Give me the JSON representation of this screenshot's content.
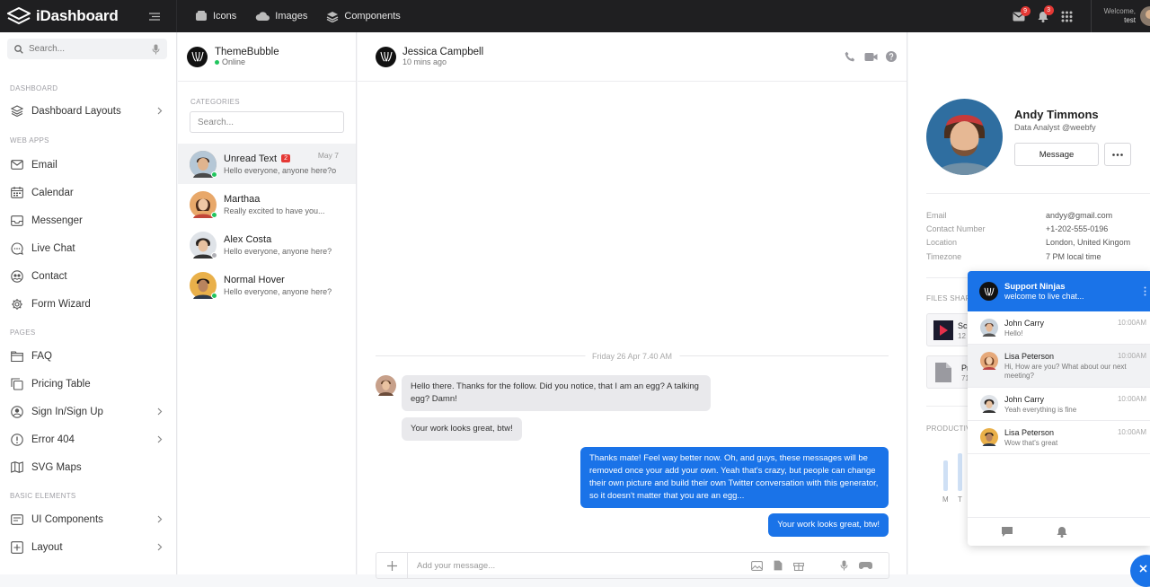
{
  "app": {
    "brand": "iDashboard"
  },
  "topnav": [
    {
      "label": "Icons",
      "icon": "icons-icon"
    },
    {
      "label": "Images",
      "icon": "cloud-icon"
    },
    {
      "label": "Components",
      "icon": "layers-icon"
    }
  ],
  "topright": {
    "mail_count": "9",
    "notif_count": "3",
    "welcome": "Welcome,",
    "username": "test"
  },
  "sidebar": {
    "search_placeholder": "Search...",
    "sections": [
      {
        "label": "DASHBOARD"
      },
      {
        "label": "WEB APPS"
      },
      {
        "label": "PAGES"
      },
      {
        "label": "BASIC ELEMENTS"
      }
    ],
    "items": [
      {
        "label": "Dashboard Layouts",
        "icon": "layers-icon"
      },
      {
        "label": "Email",
        "icon": "mail-icon"
      },
      {
        "label": "Calendar",
        "icon": "calendar-icon"
      },
      {
        "label": "Messenger",
        "icon": "inbox-icon"
      },
      {
        "label": "Live Chat",
        "icon": "chat-icon"
      },
      {
        "label": "Contact",
        "icon": "contact-icon"
      },
      {
        "label": "Form Wizard",
        "icon": "gear-icon"
      },
      {
        "label": "FAQ",
        "icon": "folder-icon"
      },
      {
        "label": "Pricing Table",
        "icon": "copy-icon"
      },
      {
        "label": "Sign In/Sign Up",
        "icon": "user-icon"
      },
      {
        "label": "Error 404",
        "icon": "error-icon"
      },
      {
        "label": "SVG Maps",
        "icon": "map-icon"
      },
      {
        "label": "UI Components",
        "icon": "ui-icon"
      },
      {
        "label": "Layout",
        "icon": "layout-icon"
      }
    ]
  },
  "chatlist": {
    "owner": "ThemeBubble",
    "status": "Online",
    "categories_label": "CATEGORIES",
    "search_placeholder": "Search...",
    "contacts": [
      {
        "name": "Unread Text",
        "count": "2",
        "date": "May 7",
        "preview": "Hello everyone, anyone here?o",
        "status_color": "#22c55e"
      },
      {
        "name": "Marthaa",
        "preview": "Really excited to have you...",
        "status_color": "#22c55e"
      },
      {
        "name": "Alex Costa",
        "preview": "Hello everyone, anyone here?",
        "status_color": "#b0b0b6"
      },
      {
        "name": "Normal Hover",
        "preview": "Hello everyone, anyone here?",
        "status_color": "#22c55e"
      }
    ]
  },
  "conversation": {
    "name": "Jessica Campbell",
    "last_seen": "10 mins ago",
    "date_divider": "Friday 26 Apr 7.40 AM",
    "messages": [
      {
        "dir": "in",
        "text": "Hello there. Thanks for the follow. Did you notice, that I am an egg? A talking egg? Damn!"
      },
      {
        "dir": "in",
        "text": "Your work looks great, btw!"
      },
      {
        "dir": "out",
        "text": "Thanks mate! Feel way better now. Oh, and guys, these messages will be removed once your add your own. Yeah that's crazy, but people can change their own picture and build their own Twitter conversation with this generator, so it doesn't matter that you are an egg..."
      },
      {
        "dir": "out",
        "text": "Your work looks great, btw!"
      }
    ],
    "composer_placeholder": "Add your message..."
  },
  "profile": {
    "name": "Andy Timmons",
    "role": "Data Analyst @weebfy",
    "message_button": "Message",
    "info": [
      {
        "key": "Email",
        "value": "andyy@gmail.com"
      },
      {
        "key": "Contact Number",
        "value": "+1-202-555-0196"
      },
      {
        "key": "Location",
        "value": "London, United Kingom"
      },
      {
        "key": "Timezone",
        "value": "7 PM local time"
      }
    ],
    "files_label": "FILES SHARE",
    "files": [
      {
        "name": "Sc",
        "sub": "12"
      },
      {
        "name": "Pr",
        "sub": "71"
      }
    ],
    "productivity_label": "PRODUCTIV",
    "days": [
      "M",
      "T"
    ]
  },
  "widget": {
    "title": "Support Ninjas",
    "subtitle": "welcome to live chat...",
    "chats": [
      {
        "name": "John Carry",
        "time": "10:00AM",
        "message": "Hello!"
      },
      {
        "name": "Lisa Peterson",
        "time": "10:00AM",
        "message": "Hi, How are you? What about our next meeting?"
      },
      {
        "name": "John Carry",
        "time": "10:00AM",
        "message": "Yeah everything is fine"
      },
      {
        "name": "Lisa Peterson",
        "time": "10:00AM",
        "message": "Wow that's great"
      }
    ]
  },
  "colors": {
    "accent": "#1a73e8",
    "topbar": "#1f1f21",
    "badge": "#e53935",
    "online": "#22c55e"
  }
}
